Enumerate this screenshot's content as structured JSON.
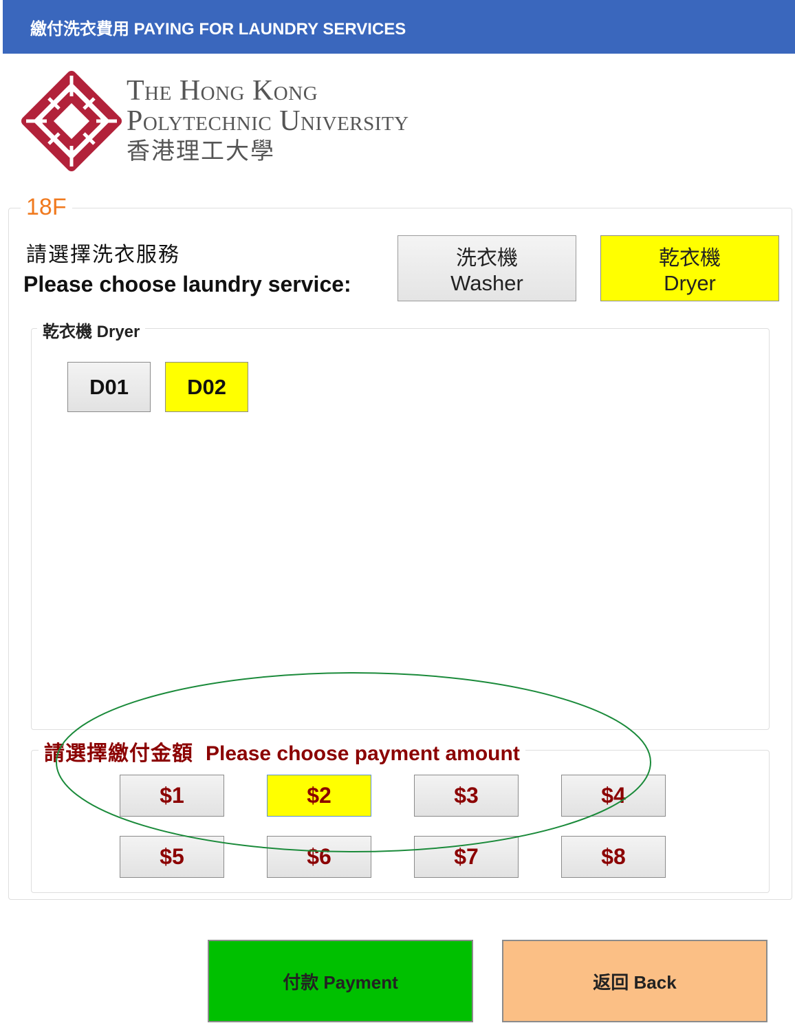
{
  "header": {
    "title": "繳付洗衣費用  PAYING FOR LAUNDRY SERVICES"
  },
  "university": {
    "line1": "The Hong Kong",
    "line2": "Polytechnic University",
    "chinese": "香港理工大學"
  },
  "floor": "18F",
  "service": {
    "prompt_chi": "請選擇洗衣服務",
    "prompt_eng": "Please choose laundry service:",
    "washer": {
      "chi": "洗衣機",
      "eng": "Washer"
    },
    "dryer": {
      "chi": "乾衣機",
      "eng": "Dryer"
    },
    "selected": "dryer"
  },
  "machines": {
    "label": "乾衣機  Dryer",
    "items": [
      "D01",
      "D02"
    ],
    "selected": "D02"
  },
  "payment": {
    "label_chi": "請選擇繳付金額",
    "label_eng": "Please choose payment amount",
    "amounts": [
      "$1",
      "$2",
      "$3",
      "$4",
      "$5",
      "$6",
      "$7",
      "$8"
    ],
    "selected": "$2"
  },
  "actions": {
    "payment": "付款  Payment",
    "back": "返回  Back"
  },
  "colors": {
    "header": "#3a67bd",
    "selected": "#ffff00",
    "floor": "#f07a1f",
    "amount_text": "#8b0000",
    "pay_button": "#00c000",
    "back_button": "#fbbf85",
    "logo": "#b2223a",
    "annotation": "#1a8a3a"
  }
}
